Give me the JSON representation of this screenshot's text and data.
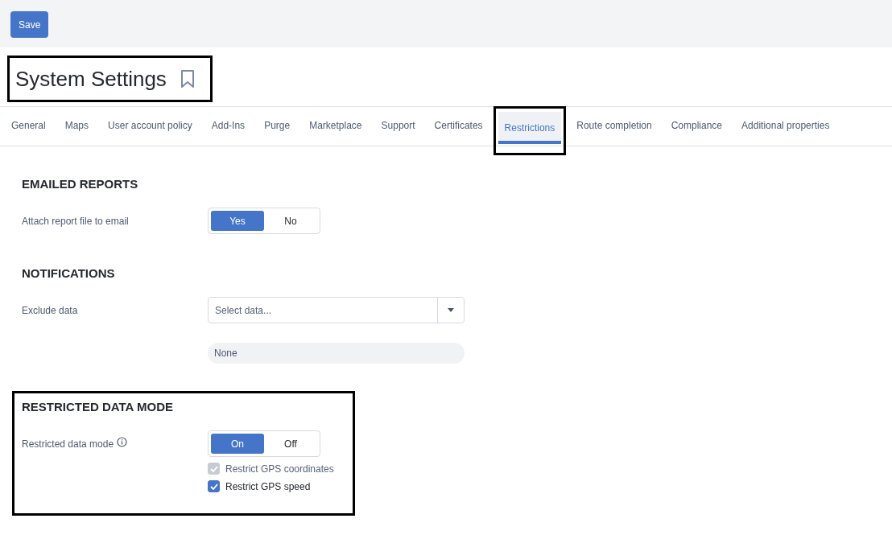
{
  "toolbar": {
    "save_button": "Save"
  },
  "page_title": {
    "text": "System Settings",
    "highlighted": true
  },
  "tabs": [
    {
      "label": "General",
      "selected": false,
      "highlighted": false
    },
    {
      "label": "Maps",
      "selected": false,
      "highlighted": false
    },
    {
      "label": "User account policy",
      "selected": false,
      "highlighted": false
    },
    {
      "label": "Add-Ins",
      "selected": false,
      "highlighted": false
    },
    {
      "label": "Purge",
      "selected": false,
      "highlighted": false
    },
    {
      "label": "Marketplace",
      "selected": false,
      "highlighted": false
    },
    {
      "label": "Support",
      "selected": false,
      "highlighted": false
    },
    {
      "label": "Certificates",
      "selected": false,
      "highlighted": false
    },
    {
      "label": "Restrictions",
      "selected": true,
      "highlighted": true
    },
    {
      "label": "Route completion",
      "selected": false,
      "highlighted": false
    },
    {
      "label": "Compliance",
      "selected": false,
      "highlighted": false
    },
    {
      "label": "Additional properties",
      "selected": false,
      "highlighted": false
    }
  ],
  "sections": [
    {
      "title": "EMAILED REPORTS",
      "highlighted": false,
      "rows": [
        {
          "kind": "toggle",
          "label": "Attach report file to email",
          "info": false,
          "options": [
            {
              "label": "Yes",
              "selected": true
            },
            {
              "label": "No",
              "selected": false
            }
          ]
        }
      ]
    },
    {
      "title": "NOTIFICATIONS",
      "highlighted": false,
      "rows": [
        {
          "kind": "select",
          "label": "Exclude data",
          "placeholder": "Select data...",
          "chips": [
            "None"
          ]
        }
      ]
    },
    {
      "title": "RESTRICTED DATA MODE",
      "highlighted": true,
      "rows": [
        {
          "kind": "toggle",
          "label": "Restricted data mode",
          "info": true,
          "options": [
            {
              "label": "On",
              "selected": true
            },
            {
              "label": "Off",
              "selected": false
            }
          ],
          "checkboxes": [
            {
              "label": "Restrict GPS coordinates",
              "checked": true,
              "disabled": true
            },
            {
              "label": "Restrict GPS speed",
              "checked": true,
              "disabled": false
            }
          ]
        }
      ]
    }
  ]
}
